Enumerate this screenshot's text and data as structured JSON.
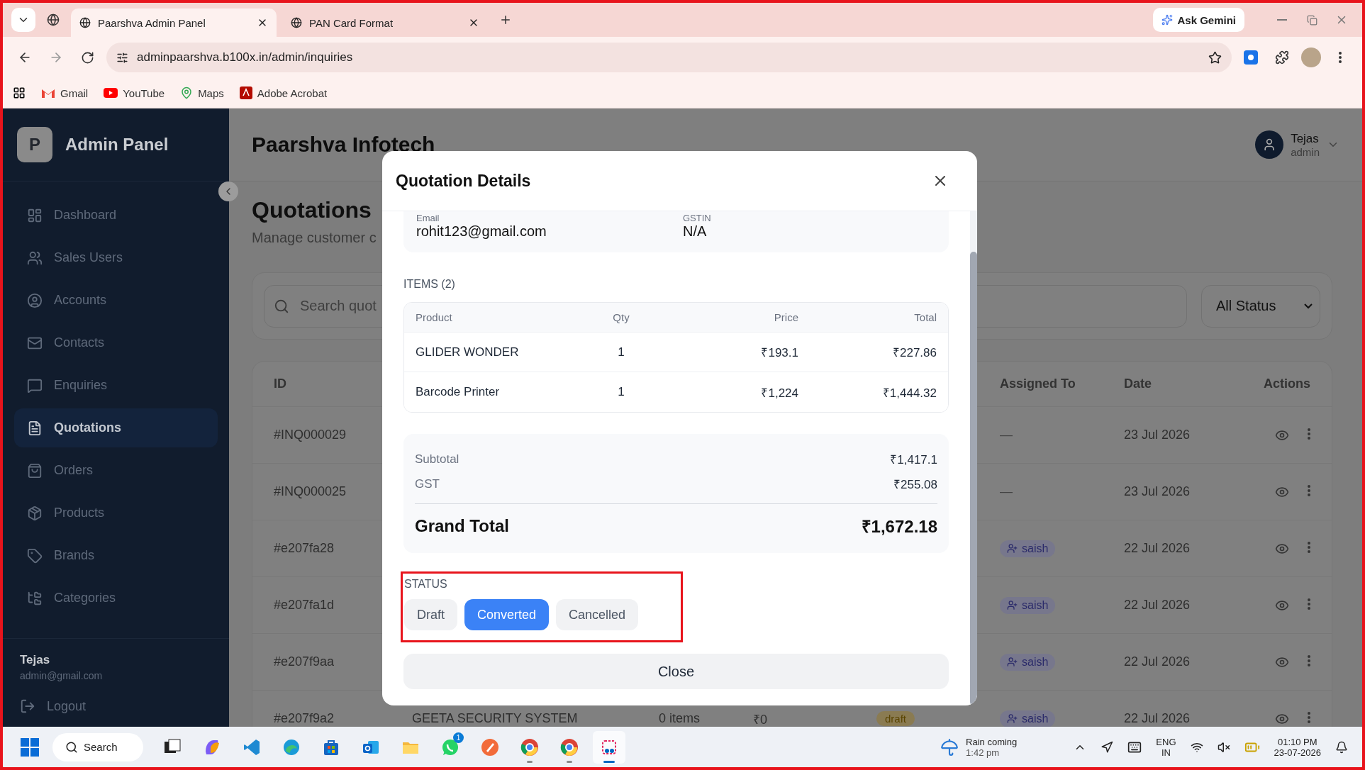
{
  "browser": {
    "tabs": [
      {
        "title": "Paarshva Admin Panel",
        "selected": true
      },
      {
        "title": "PAN Card Format",
        "selected": false
      }
    ],
    "gemini": "Ask Gemini",
    "url": "adminpaarshva.b100x.in/admin/inquiries",
    "bookmarks": [
      "Gmail",
      "YouTube",
      "Maps",
      "Adobe Acrobat"
    ]
  },
  "sidebar": {
    "logo": "P",
    "title": "Admin Panel",
    "items": [
      {
        "label": "Dashboard",
        "selected": false
      },
      {
        "label": "Sales Users",
        "selected": false
      },
      {
        "label": "Accounts",
        "selected": false
      },
      {
        "label": "Contacts",
        "selected": false
      },
      {
        "label": "Enquiries",
        "selected": false
      },
      {
        "label": "Quotations",
        "selected": true
      },
      {
        "label": "Orders",
        "selected": false
      },
      {
        "label": "Products",
        "selected": false
      },
      {
        "label": "Brands",
        "selected": false
      },
      {
        "label": "Categories",
        "selected": false
      }
    ],
    "user": {
      "name": "Tejas",
      "email": "admin@gmail.com"
    },
    "logout": "Logout"
  },
  "header": {
    "title": "Paarshva Infotech",
    "user_name": "Tejas",
    "user_role": "admin"
  },
  "page": {
    "title": "Quotations",
    "subtitle": "Manage customer c",
    "search_placeholder": "Search quot",
    "status_filter": "All Status"
  },
  "table": {
    "columns": [
      "ID",
      "Assigned To",
      "Date",
      "Actions"
    ],
    "rows": [
      {
        "id": "#INQ000029",
        "assigned": {
          "kind": "empty",
          "text": "—"
        },
        "date": "23 Jul 2026"
      },
      {
        "id": "#INQ000025",
        "assigned": {
          "kind": "empty",
          "text": "—"
        },
        "date": "23 Jul 2026"
      },
      {
        "id": "#e207fa28",
        "assigned": {
          "kind": "user",
          "text": "saish"
        },
        "date": "22 Jul 2026"
      },
      {
        "id": "#e207fa1d",
        "assigned": {
          "kind": "user",
          "text": "saish"
        },
        "date": "22 Jul 2026"
      },
      {
        "id": "#e207f9aa",
        "assigned": {
          "kind": "user",
          "text": "saish"
        },
        "date": "22 Jul 2026"
      },
      {
        "id": "#e207f9a2",
        "customer": "GEETA SECURITY SYSTEM",
        "items": "0 items",
        "amount": "₹0",
        "status": "draft",
        "assigned": {
          "kind": "user",
          "text": "saish"
        },
        "date": "22 Jul 2026"
      }
    ]
  },
  "modal": {
    "title": "Quotation Details",
    "customer_fields": [
      {
        "label": "Email",
        "value": "rohit123@gmail.com"
      },
      {
        "label": "GSTIN",
        "value": "N/A"
      }
    ],
    "items_heading": "ITEMS (2)",
    "item_columns": [
      "Product",
      "Qty",
      "Price",
      "Total"
    ],
    "items": [
      {
        "product": "GLIDER WONDER",
        "qty": "1",
        "price": "₹193.1",
        "total": "₹227.86"
      },
      {
        "product": "Barcode Printer",
        "qty": "1",
        "price": "₹1,224",
        "total": "₹1,444.32"
      }
    ],
    "summary": [
      {
        "label": "Subtotal",
        "value": "₹1,417.1"
      },
      {
        "label": "GST",
        "value": "₹255.08"
      }
    ],
    "grand_total": {
      "label": "Grand Total",
      "value": "₹1,672.18"
    },
    "status_heading": "STATUS",
    "statuses": [
      {
        "label": "Draft",
        "selected": false
      },
      {
        "label": "Converted",
        "selected": true
      },
      {
        "label": "Cancelled",
        "selected": false
      }
    ],
    "close": "Close"
  },
  "taskbar": {
    "search": "Search",
    "apps": [
      {
        "kind": "taskview",
        "running": false,
        "active": false
      },
      {
        "kind": "copilot",
        "running": false,
        "active": false
      },
      {
        "kind": "vscode",
        "running": false,
        "active": false
      },
      {
        "kind": "edge",
        "running": false,
        "active": false
      },
      {
        "kind": "store",
        "running": false,
        "active": false
      },
      {
        "kind": "outlook",
        "running": false,
        "active": false
      },
      {
        "kind": "explorer",
        "running": false,
        "active": false
      },
      {
        "kind": "whatsapp",
        "running": false,
        "active": false,
        "badge": "1"
      },
      {
        "kind": "pen",
        "running": false,
        "active": false
      },
      {
        "kind": "chrome",
        "running": true,
        "active": false
      },
      {
        "kind": "chrome",
        "running": true,
        "active": false
      },
      {
        "kind": "snip",
        "running": true,
        "active": true
      }
    ],
    "weather": {
      "title": "Rain coming",
      "time": "1:42 pm"
    },
    "language": "ENG",
    "region": "IN",
    "time": "01:10 PM",
    "date": "23-07-2026"
  }
}
